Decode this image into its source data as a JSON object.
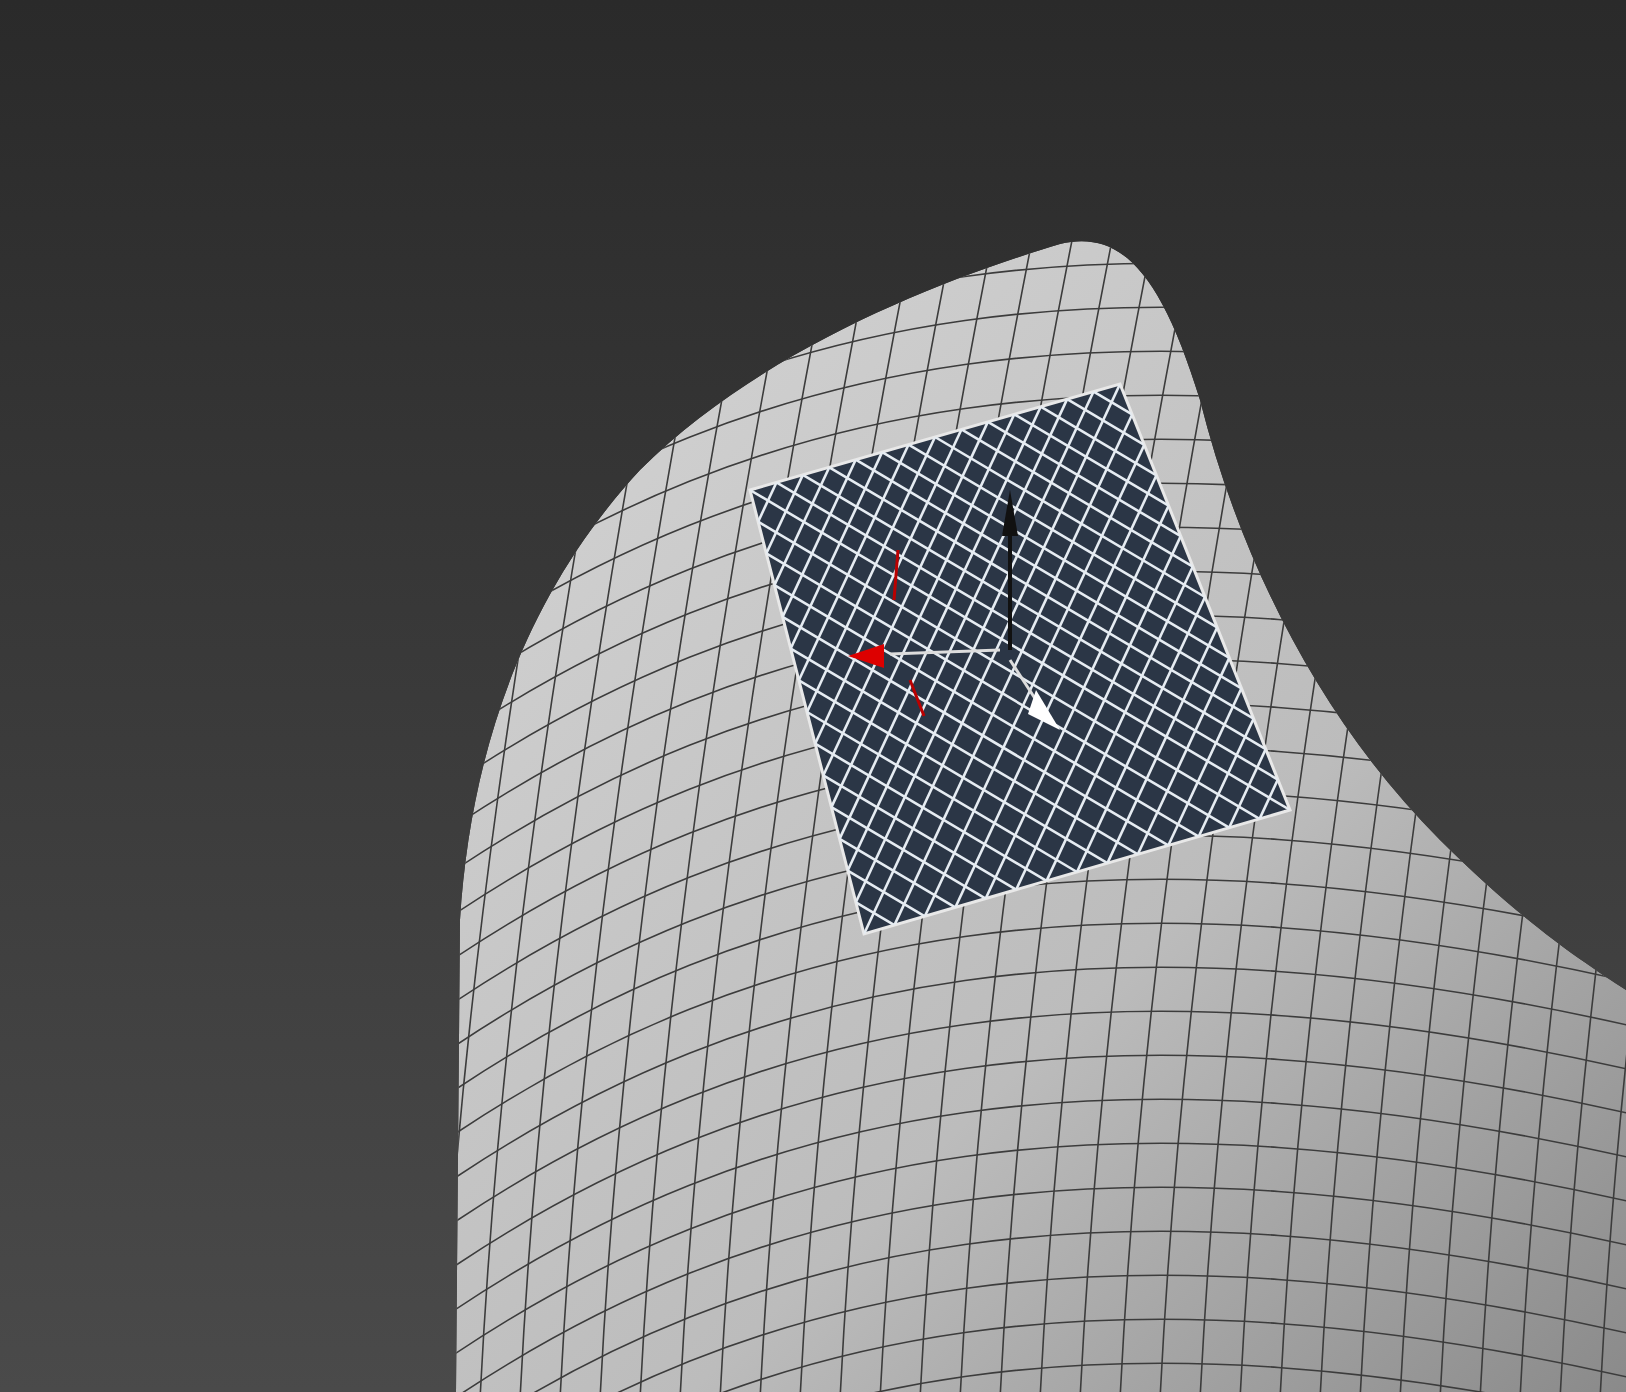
{
  "viewport": {
    "wireframe": true,
    "gizmo_visible": true
  }
}
